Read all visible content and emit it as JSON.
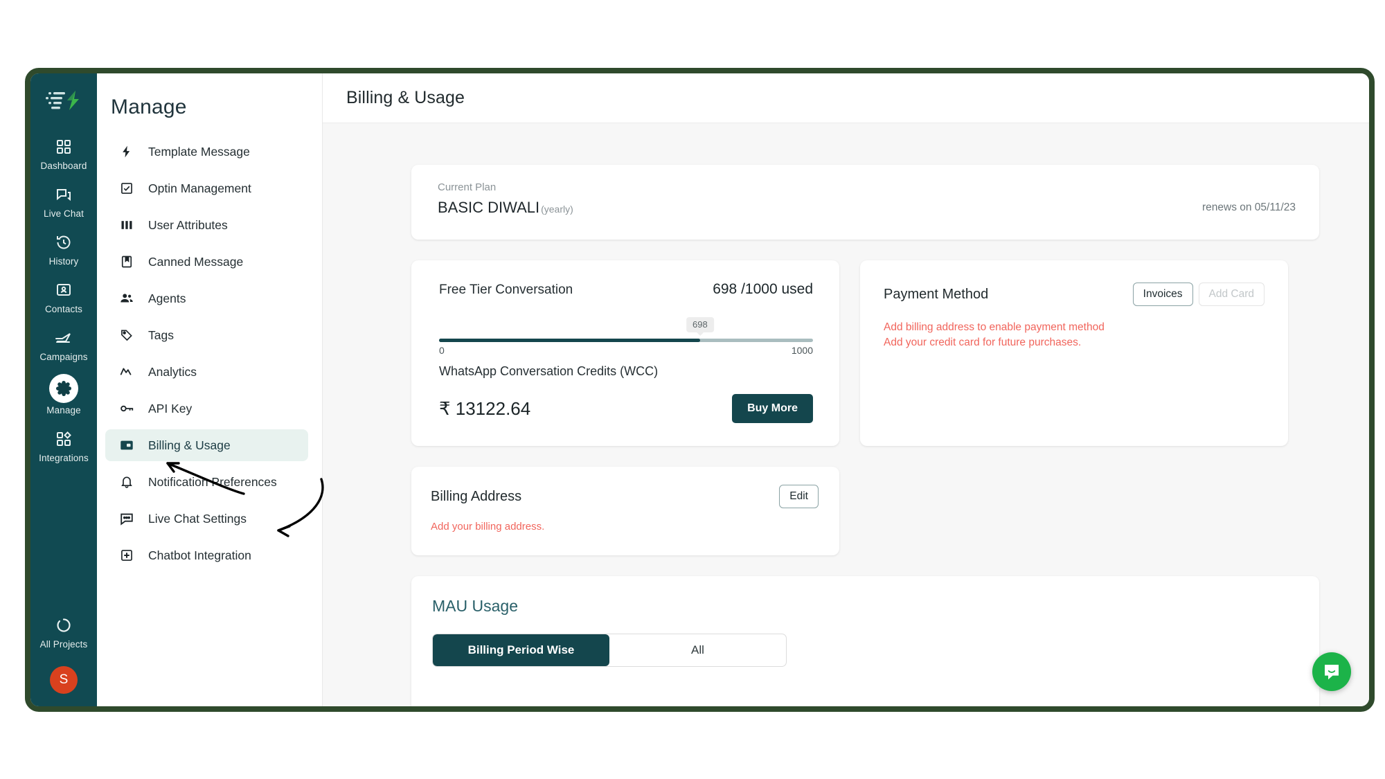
{
  "window": {
    "border_color": "#2f4a2c"
  },
  "rail": {
    "logo_name": "app-logo",
    "items": [
      {
        "label": "Dashboard",
        "icon": "grid-icon",
        "active": false
      },
      {
        "label": "Live Chat",
        "icon": "chat-icon",
        "active": false
      },
      {
        "label": "History",
        "icon": "history-icon",
        "active": false
      },
      {
        "label": "Contacts",
        "icon": "contacts-icon",
        "active": false
      },
      {
        "label": "Campaigns",
        "icon": "send-icon",
        "active": false
      },
      {
        "label": "Manage",
        "icon": "gear-icon",
        "active": true
      },
      {
        "label": "Integrations",
        "icon": "integrations-icon",
        "active": false
      }
    ],
    "bottom": {
      "all_projects_label": "All Projects",
      "all_projects_icon": "refresh-circle-icon",
      "avatar_initial": "S",
      "avatar_color": "#d9411e"
    }
  },
  "nav": {
    "title": "Manage",
    "items": [
      {
        "label": "Template Message",
        "icon": "bolt-icon",
        "active": false
      },
      {
        "label": "Optin Management",
        "icon": "checkbox-icon",
        "active": false
      },
      {
        "label": "User Attributes",
        "icon": "columns-icon",
        "active": false
      },
      {
        "label": "Canned Message",
        "icon": "bookmark-icon",
        "active": false
      },
      {
        "label": "Agents",
        "icon": "people-icon",
        "active": false
      },
      {
        "label": "Tags",
        "icon": "tag-icon",
        "active": false
      },
      {
        "label": "Analytics",
        "icon": "analytics-icon",
        "active": false
      },
      {
        "label": "API Key",
        "icon": "key-icon",
        "active": false
      },
      {
        "label": "Billing & Usage",
        "icon": "wallet-icon",
        "active": true
      },
      {
        "label": "Notification Preferences",
        "icon": "bell-icon",
        "active": false
      },
      {
        "label": "Live Chat Settings",
        "icon": "chat-bubble-icon",
        "active": false
      },
      {
        "label": "Chatbot Integration",
        "icon": "plus-square-icon",
        "active": false
      }
    ]
  },
  "topbar": {
    "title": "Billing & Usage"
  },
  "plan": {
    "label": "Current Plan",
    "name": "BASIC DIWALI",
    "cycle": "(yearly)",
    "renews": "renews on 05/11/23"
  },
  "free_tier": {
    "title": "Free Tier Conversation",
    "used_text": "698 /1000 used",
    "bubble_value": "698",
    "min": "0",
    "max": "1000",
    "used": 698,
    "limit": 1000,
    "percent": 69.8,
    "wcc_label": "WhatsApp Conversation Credits (WCC)",
    "wcc_amount": "₹ 13122.64",
    "buy_button": "Buy More"
  },
  "payment": {
    "title": "Payment Method",
    "invoices_button": "Invoices",
    "add_card_button": "Add Card",
    "warning_line1": "Add billing address to enable payment method",
    "warning_line2": "Add your credit card for future purchases.",
    "warning_color": "#f1655c"
  },
  "billing_address": {
    "title": "Billing Address",
    "edit_button": "Edit",
    "warning": "Add your billing address."
  },
  "mau": {
    "title": "MAU Usage",
    "tabs": [
      {
        "label": "Billing Period Wise",
        "active": true
      },
      {
        "label": "All",
        "active": false
      }
    ]
  },
  "intercom": {
    "name": "intercom-launcher",
    "icon": "messenger-icon",
    "color": "#1cb349"
  }
}
